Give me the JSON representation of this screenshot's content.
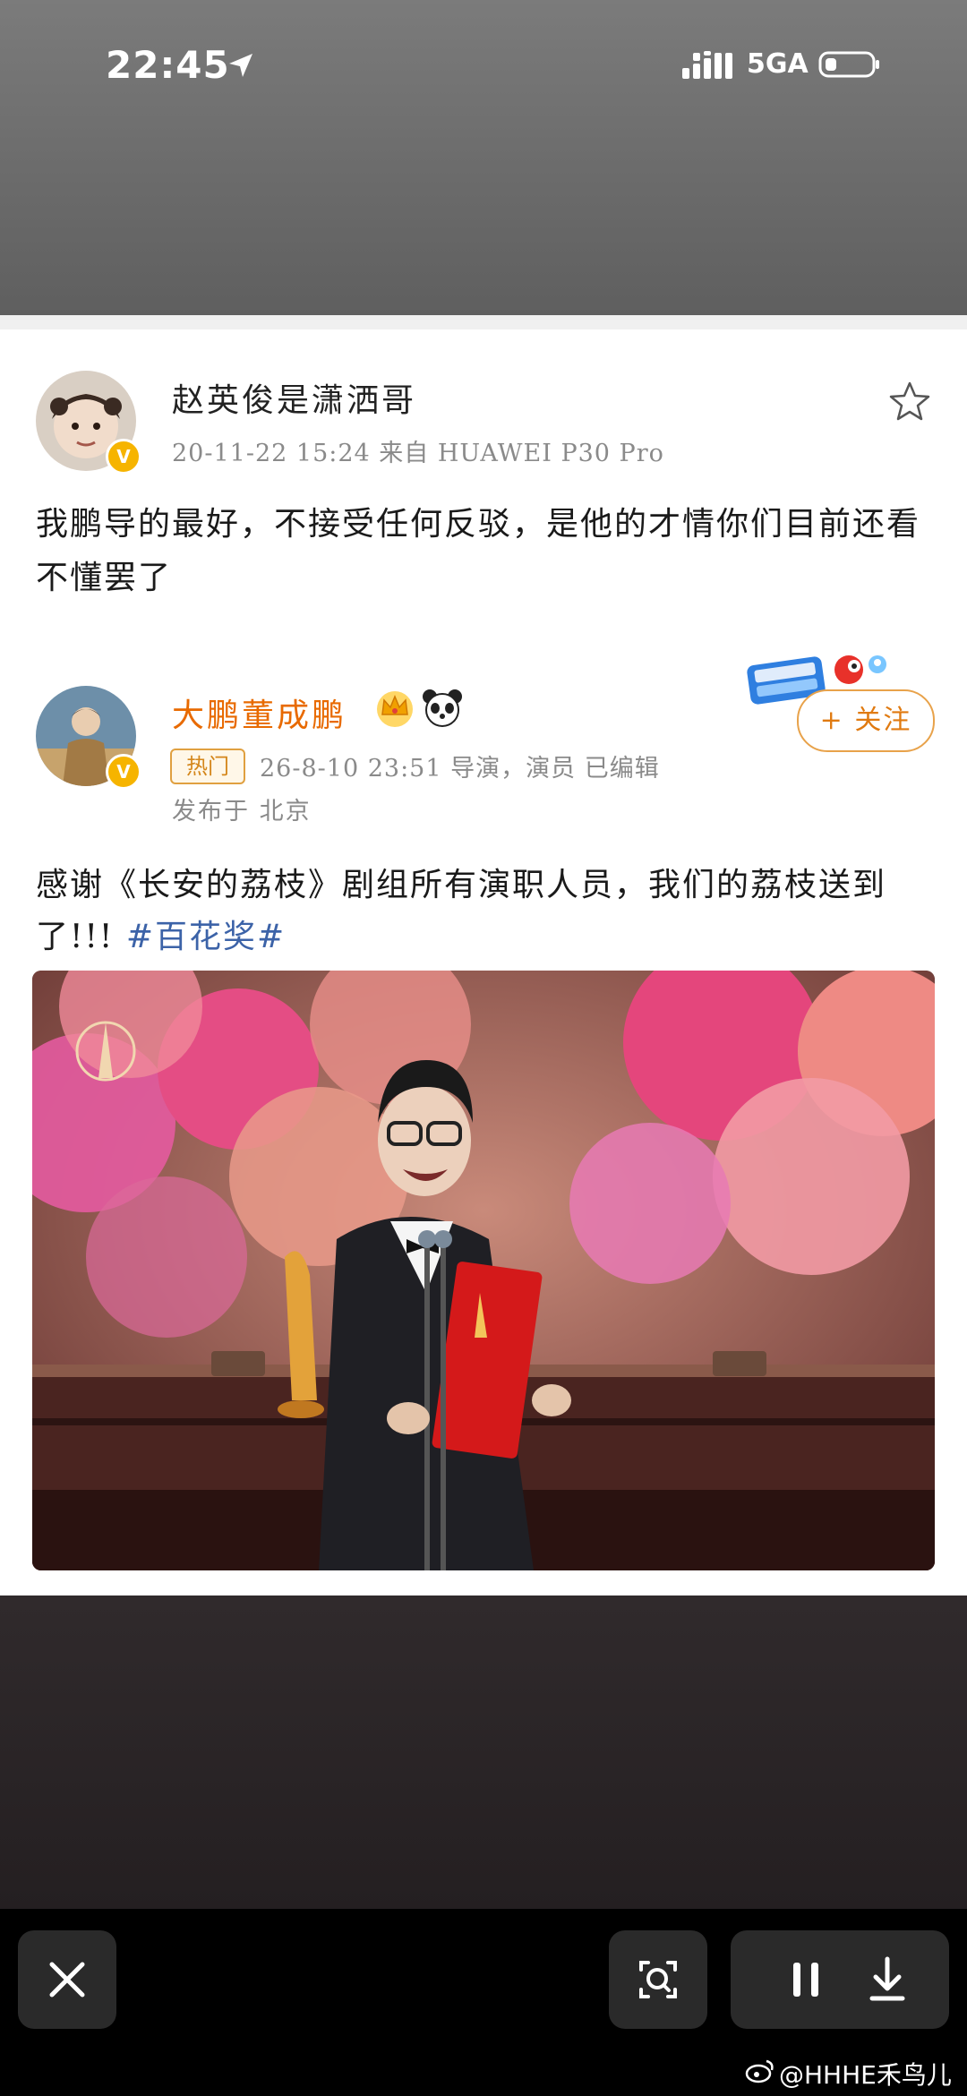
{
  "status_bar": {
    "time": "22:45",
    "network": "5GA"
  },
  "post_original": {
    "author": "赵英俊是潇洒哥",
    "meta": "20-11-22 15:24  来自 HUAWEI P30 Pro",
    "text": "我鹏导的最好，不接受任何反驳，是他的才情你们目前还看不懂罢了"
  },
  "post_quoted": {
    "author": "大鹏董成鹏",
    "badge": "热门",
    "meta": "26-8-10 23:51  导演，演员  已编辑",
    "location": "发布于 北京",
    "follow_label": "+ 关注",
    "text": "感谢《长安的荔枝》剧组所有演职人员，我们的荔枝送到了!!! ",
    "hashtag": "#百花奖#"
  },
  "toolbar": {
    "close": "close",
    "lens": "lens",
    "pause": "pause",
    "download": "download"
  },
  "watermark": "@HHHE禾鸟儿",
  "colors": {
    "accent_orange": "#e86a00",
    "hashtag_blue": "#3c63a8",
    "verified_gold": "#f6b400"
  }
}
